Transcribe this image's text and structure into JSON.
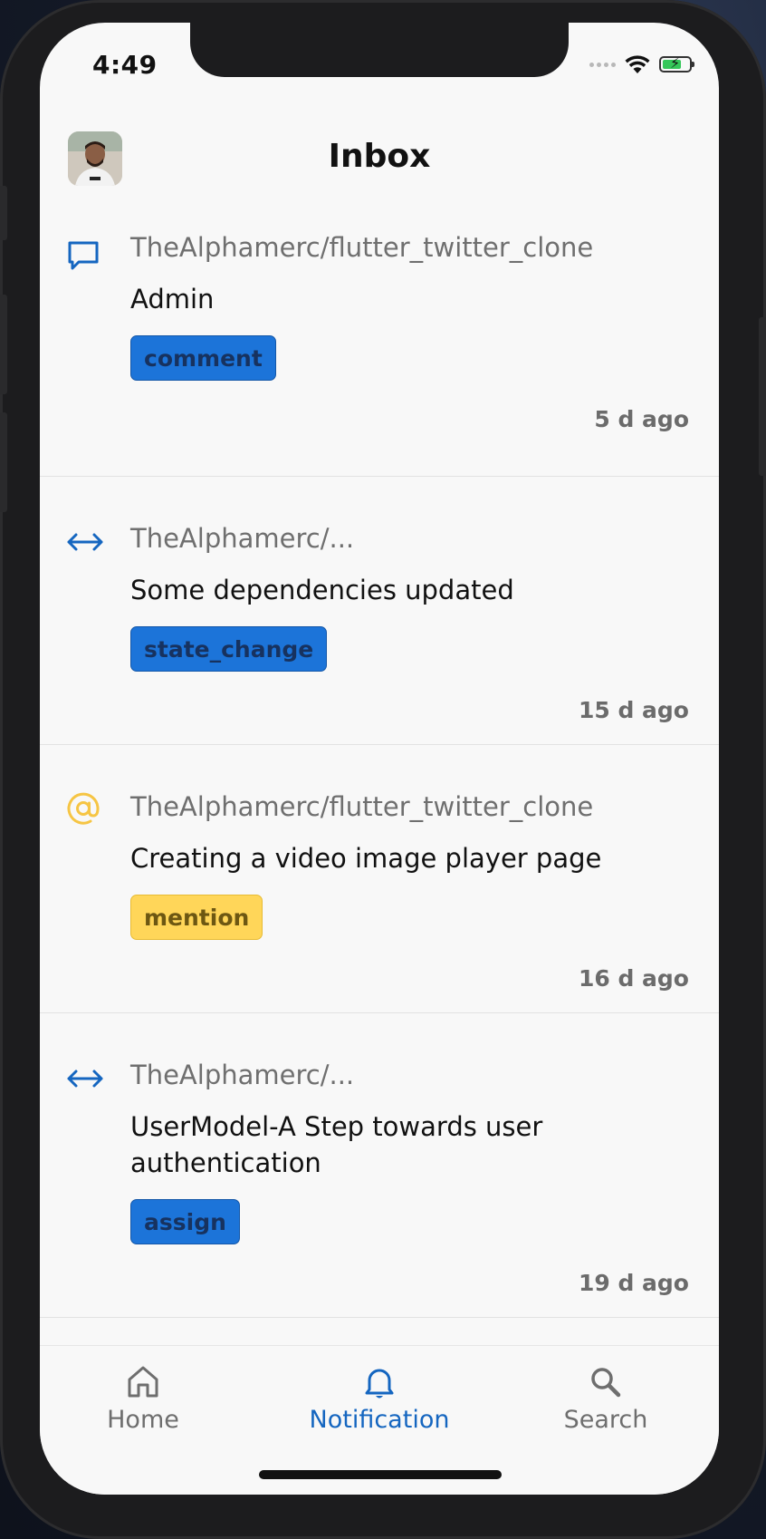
{
  "status_bar": {
    "time": "4:49"
  },
  "header": {
    "title": "Inbox"
  },
  "notifications": [
    {
      "icon": "comment-icon",
      "repo": "TheAlphamerc/flutter_twitter_clone",
      "title": "Admin",
      "tag": "comment",
      "tag_color": "#1c74d9",
      "time": "5 d ago"
    },
    {
      "icon": "arrows-horizontal-icon",
      "repo": "TheAlphamerc/...",
      "title": "Some dependencies updated",
      "tag": "state_change",
      "tag_color": "#1c74d9",
      "time": "15 d ago"
    },
    {
      "icon": "at-sign-icon",
      "repo": "TheAlphamerc/flutter_twitter_clone",
      "title": "Creating a video image player page",
      "tag": "mention",
      "tag_color": "#ffd659",
      "time": "16 d ago"
    },
    {
      "icon": "arrows-horizontal-icon",
      "repo": "TheAlphamerc/...",
      "title": "UserModel-A Step towards user authentication",
      "tag": "assign",
      "tag_color": "#1c74d9",
      "time": "19 d ago"
    }
  ],
  "tabbar": {
    "tabs": [
      {
        "label": "Home",
        "icon": "home-icon",
        "active": false
      },
      {
        "label": "Notification",
        "icon": "bell-icon",
        "active": true
      },
      {
        "label": "Search",
        "icon": "search-icon",
        "active": false
      }
    ]
  },
  "colors": {
    "accent": "#1566c0",
    "tag_blue": "#1c74d9",
    "tag_yellow": "#ffd659"
  }
}
